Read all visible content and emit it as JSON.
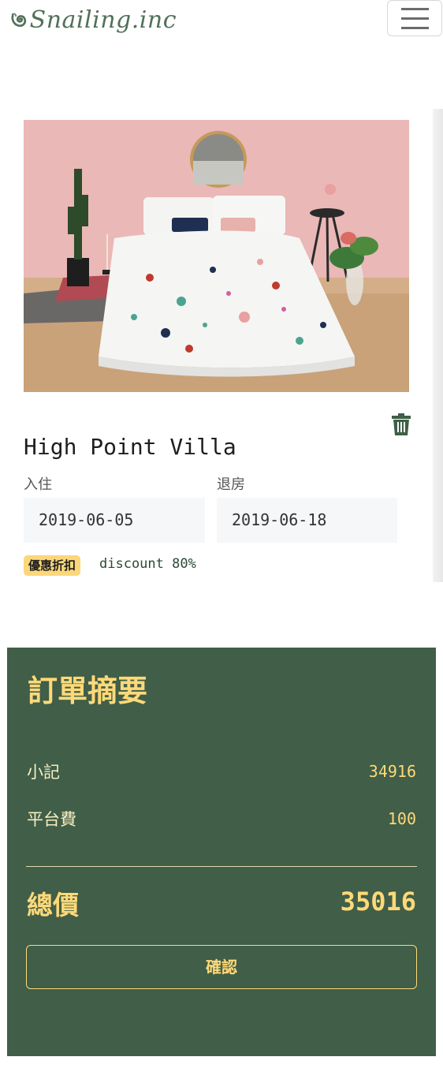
{
  "brand": {
    "name": "Snailing.inc",
    "logo_icon": "snail-spiral-icon",
    "accent": "#52705a"
  },
  "nav": {
    "menu_icon": "hamburger-menu-icon"
  },
  "product": {
    "name": "High Point Villa",
    "checkin_label": "入住",
    "checkin_date": "2019-06-05",
    "checkout_label": "退房",
    "checkout_date": "2019-06-18",
    "badge": "優惠折扣",
    "discount_text": "discount 80%",
    "delete_icon": "trash-icon"
  },
  "summary": {
    "title": "訂單摘要",
    "subtotal_label": "小記",
    "subtotal_value": "34916",
    "fee_label": "平台費",
    "fee_value": "100",
    "total_label": "總價",
    "total_value": "35016",
    "confirm_label": "確認",
    "bg_color": "#405e48",
    "accent_color": "#ffd978"
  }
}
